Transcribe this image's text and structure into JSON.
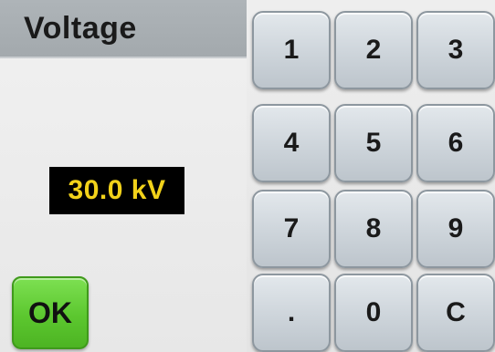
{
  "title": "Voltage",
  "value_display": "30.0 kV",
  "ok_label": "OK",
  "keys": [
    "1",
    "2",
    "3",
    "4",
    "5",
    "6",
    "7",
    "8",
    "9",
    ".",
    "0",
    "C"
  ],
  "colors": {
    "title_bar": "#a8aeb2",
    "value_background": "#000000",
    "value_text": "#f2d21a",
    "ok_button": "#5cc72f",
    "key_face": "#cfd6dc"
  }
}
